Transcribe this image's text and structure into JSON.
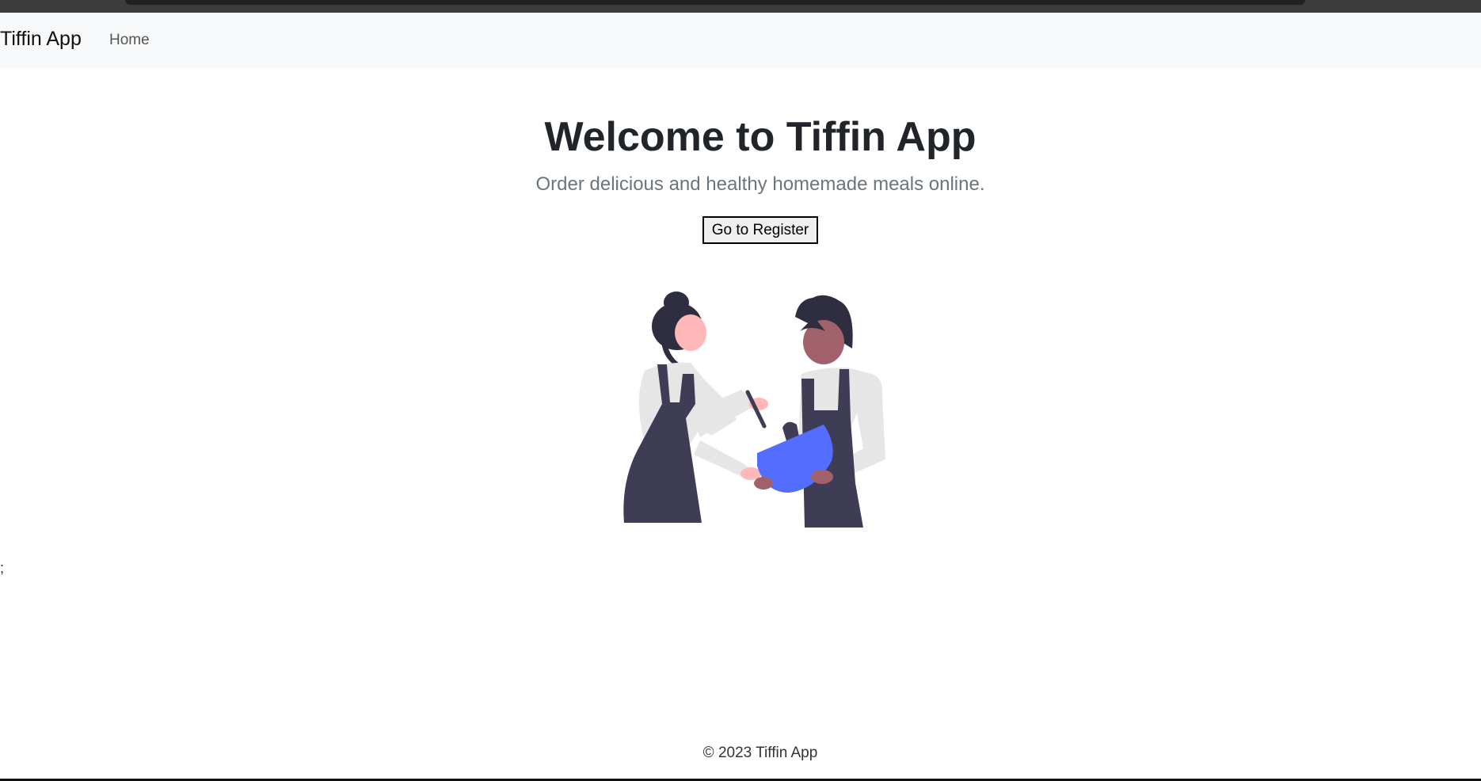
{
  "navbar": {
    "brand": "Tiffin App",
    "links": [
      {
        "label": "Home"
      }
    ]
  },
  "hero": {
    "title": "Welcome to Tiffin App",
    "subtitle": "Order delicious and healthy homemade meals online.",
    "button_label": "Go to Register"
  },
  "illustration": {
    "icon": "two-cooks-mixing-bowl-illustration",
    "colors": {
      "apron": "#3f3d56",
      "hair": "#2f2e41",
      "shirt": "#e6e6e6",
      "skin_light": "#ffb8b8",
      "skin_dark": "#a0616a",
      "bowl": "#536dfe"
    }
  },
  "stray_text": ";",
  "footer": {
    "text": "© 2023 Tiffin App"
  }
}
